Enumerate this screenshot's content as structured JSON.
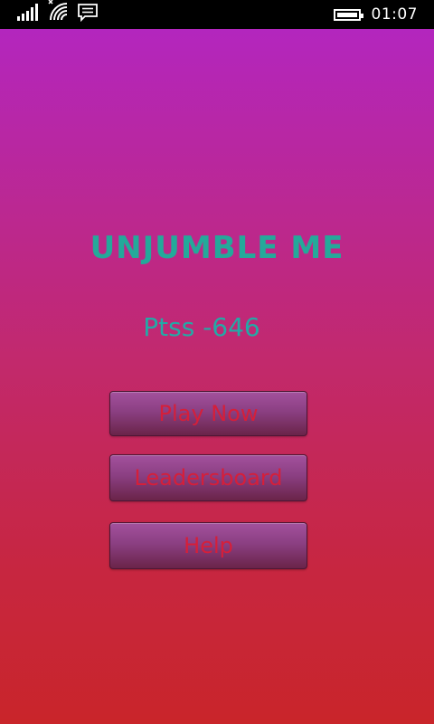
{
  "status_bar": {
    "time": "01:07",
    "icons": [
      "signal-strength-icon",
      "wifi-icon",
      "message-icon",
      "battery-icon"
    ]
  },
  "colors": {
    "title": "#24a99a",
    "points": "#24a9a6",
    "button_text": "#d51f3a",
    "gradient_top": "#b326be",
    "gradient_bottom": "#c9252a"
  },
  "app": {
    "title": "UNJUMBLE ME",
    "points_text": "Ptss -646"
  },
  "menu": {
    "play_label": "Play Now",
    "leaderboard_label": "Leadersboard",
    "help_label": "Help"
  }
}
